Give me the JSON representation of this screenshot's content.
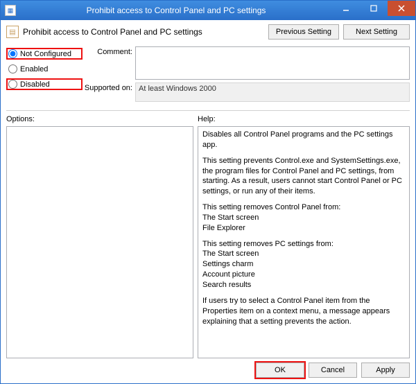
{
  "window": {
    "title": "Prohibit access to Control Panel and PC settings"
  },
  "header": {
    "label": "Prohibit access to Control Panel and PC settings",
    "prev": "Previous Setting",
    "next": "Next Setting"
  },
  "state": {
    "not_configured": "Not Configured",
    "enabled": "Enabled",
    "disabled": "Disabled"
  },
  "comment": {
    "label": "Comment:",
    "value": ""
  },
  "supported": {
    "label": "Supported on:",
    "value": "At least Windows 2000"
  },
  "panes": {
    "options_label": "Options:",
    "help_label": "Help:"
  },
  "help": {
    "p1": "Disables all Control Panel programs and the PC settings app.",
    "p2": "This setting prevents Control.exe and SystemSettings.exe, the program files for Control Panel and PC settings, from starting. As a result, users cannot start Control Panel or PC settings, or run any of their items.",
    "p3": "This setting removes Control Panel from:\nThe Start screen\nFile Explorer",
    "p4": "This setting removes PC settings from:\nThe Start screen\nSettings charm\nAccount picture\nSearch results",
    "p5": "If users try to select a Control Panel item from the Properties item on a context menu, a message appears explaining that a setting prevents the action."
  },
  "footer": {
    "ok": "OK",
    "cancel": "Cancel",
    "apply": "Apply"
  }
}
